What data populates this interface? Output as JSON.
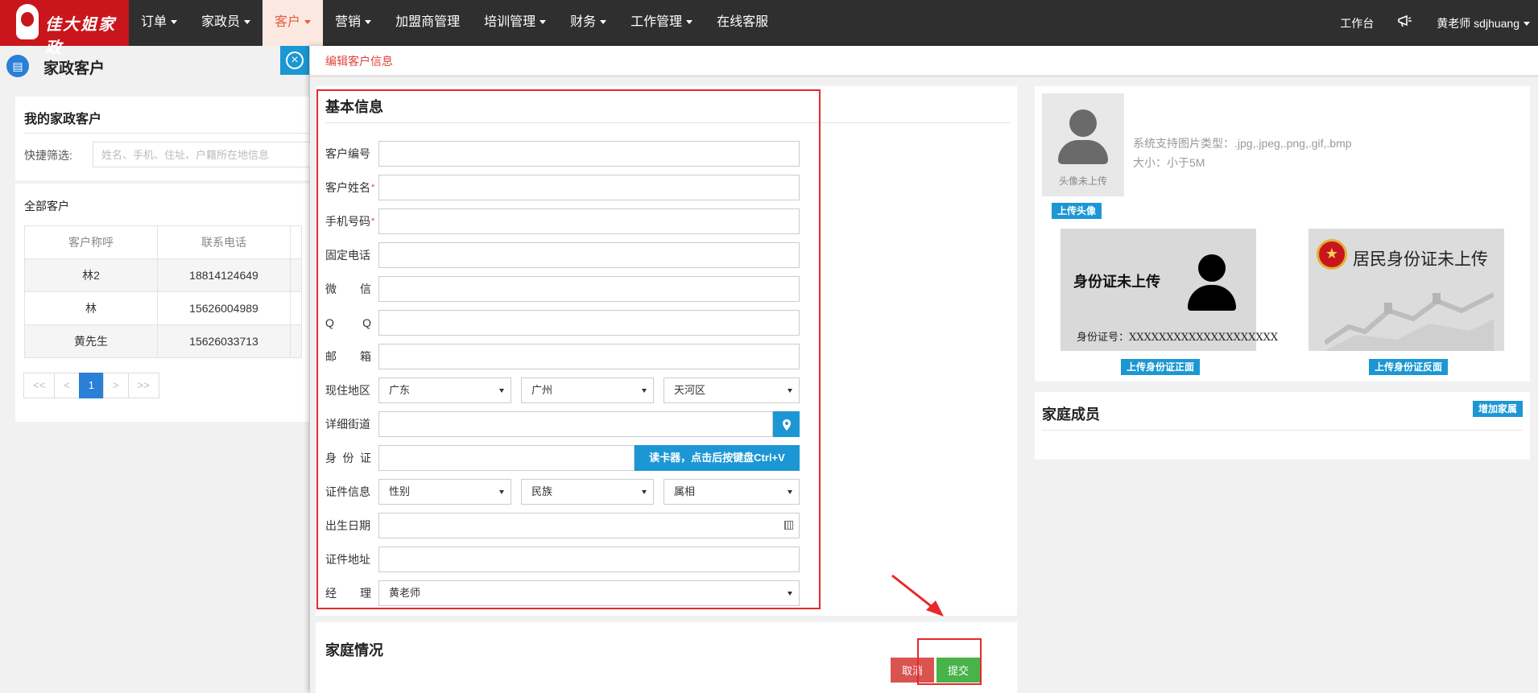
{
  "nav": {
    "brand": "佳大姐家政",
    "items": [
      {
        "label": "订单",
        "dropdown": true,
        "active": false
      },
      {
        "label": "家政员",
        "dropdown": true,
        "active": false
      },
      {
        "label": "客户",
        "dropdown": true,
        "active": true
      },
      {
        "label": "营销",
        "dropdown": true,
        "active": false
      },
      {
        "label": "加盟商管理",
        "dropdown": false,
        "active": false
      },
      {
        "label": "培训管理",
        "dropdown": true,
        "active": false
      },
      {
        "label": "财务",
        "dropdown": true,
        "active": false
      },
      {
        "label": "工作管理",
        "dropdown": true,
        "active": false
      },
      {
        "label": "在线客服",
        "dropdown": false,
        "active": false
      }
    ],
    "workbench": "工作台",
    "bell_icon": "megaphone-icon",
    "user": "黄老师",
    "username": "sdjhuang"
  },
  "left": {
    "page_title": "家政客户",
    "my_customers_title": "我的家政客户",
    "quick_filter_label": "快捷筛选:",
    "quick_filter_placeholder": "姓名、手机、住址、户籍所在地信息",
    "all_customers_title": "全部客户",
    "table": {
      "headers": [
        "客户称呼",
        "联系电话"
      ],
      "rows": [
        [
          "林2",
          "18814124649"
        ],
        [
          "林",
          "15626004989"
        ],
        [
          "黄先生",
          "15626033713"
        ]
      ]
    },
    "pager": [
      "<<",
      "<",
      "1",
      ">",
      ">>"
    ]
  },
  "breadcrumb": "编辑客户信息",
  "basic": {
    "title": "基本信息",
    "fields": {
      "customer_no": {
        "label": "客户编号",
        "value": ""
      },
      "customer_name": {
        "label": "客户姓名",
        "value": "",
        "required": true
      },
      "mobile": {
        "label": "手机号码",
        "value": "",
        "required": true
      },
      "landline": {
        "label": "固定电话",
        "value": ""
      },
      "wechat": {
        "label": [
          "微",
          "信"
        ],
        "value": ""
      },
      "qq": {
        "label": [
          "Q",
          "Q"
        ],
        "value": ""
      },
      "email": {
        "label": [
          "邮",
          "箱"
        ],
        "value": ""
      },
      "region": {
        "label": "现住地区",
        "province": "广东",
        "city": "广州",
        "district": "天河区"
      },
      "street": {
        "label": "详细街道",
        "value": ""
      },
      "idcard": {
        "label": [
          "身",
          "份",
          "证"
        ],
        "value": "",
        "reader_button": "读卡器，点击后按键盘Ctrl+V"
      },
      "cert_info": {
        "label": "证件信息",
        "gender": "性别",
        "ethnicity": "民族",
        "zodiac": "属相"
      },
      "birthday": {
        "label": "出生日期",
        "value": ""
      },
      "cert_address": {
        "label": "证件地址",
        "value": ""
      },
      "manager": {
        "label": [
          "经",
          "理"
        ],
        "value": "黄老师"
      }
    }
  },
  "family": {
    "title": "家庭情况",
    "cancel_label": "取消",
    "submit_label": "提交"
  },
  "photo": {
    "avatar_caption": "头像未上传",
    "hint_types": "系统支持图片类型：.jpg,.jpeg,.png,.gif,.bmp",
    "hint_size": "大小：小于5M",
    "upload_avatar": "上传头像",
    "id_front_text": "身份证未上传",
    "id_front_number": "身份证号：XXXXXXXXXXXXXXXXXXXX",
    "id_back_text": "居民身份证未上传",
    "upload_front": "上传身份证正面",
    "upload_back": "上传身份证反面"
  },
  "members": {
    "title": "家庭成员",
    "add_button": "增加家属"
  },
  "colors": {
    "nav_bg": "#2f2f2f",
    "logo_red": "#c9161c",
    "accent_blue": "#1c97d4",
    "annotation_red": "#e8282a",
    "submit_green": "#48b348",
    "cancel_red": "#d9534f"
  }
}
